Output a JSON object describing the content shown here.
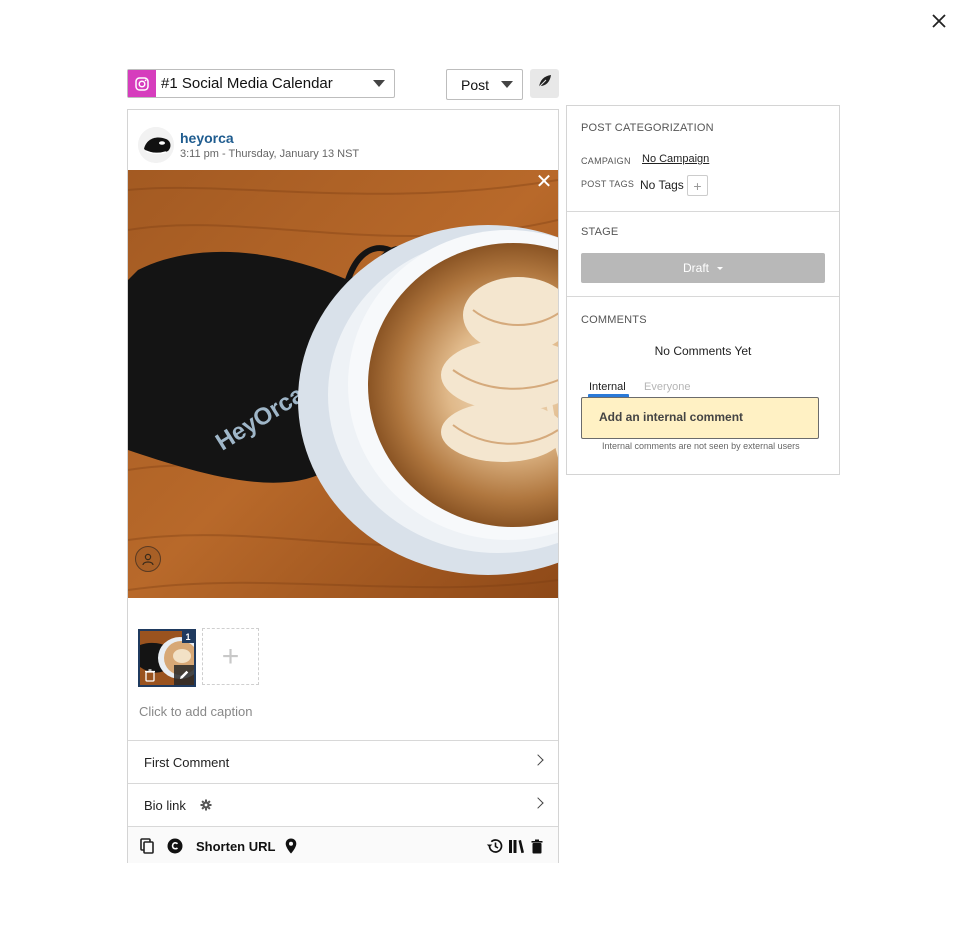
{
  "header": {
    "calendar_name": "#1 Social Media Calendar",
    "post_type": "Post"
  },
  "post": {
    "username": "heyorca",
    "timestamp": "3:11 pm - Thursday, January 13 NST",
    "photo_mask_text": "HeyOrca!",
    "thumbnail_index": "1",
    "caption_placeholder": "Click to add caption",
    "rows": {
      "first_comment": "First Comment",
      "bio_link": "Bio link"
    },
    "toolbar": {
      "shorten_url": "Shorten URL"
    }
  },
  "sidebar": {
    "categorization": {
      "title": "POST CATEGORIZATION",
      "campaign_label": "CAMPAIGN",
      "campaign_value": "No Campaign",
      "tags_label": "POST TAGS",
      "tags_value": "No Tags"
    },
    "stage": {
      "title": "STAGE",
      "value": "Draft"
    },
    "comments": {
      "title": "COMMENTS",
      "empty_text": "No Comments Yet",
      "tab_internal": "Internal",
      "tab_everyone": "Everyone",
      "placeholder": "Add an internal comment",
      "hint": "Internal comments are not seen by external users"
    }
  },
  "colors": {
    "instagram_badge": "#d63dbd",
    "username": "#1f5c8f",
    "active_tab": "#2a7ad8",
    "comment_box": "#fff1c4",
    "stage_button": "#b8b8b8"
  },
  "icons": [
    "close-icon",
    "instagram-icon",
    "caret-down-icon",
    "leaf-icon",
    "user-tag-icon",
    "trash-icon",
    "edit-icon",
    "plus-icon",
    "chevron-right-icon",
    "gear-icon",
    "copy-icon",
    "copyright-icon",
    "location-pin-icon",
    "history-icon",
    "library-icon"
  ]
}
